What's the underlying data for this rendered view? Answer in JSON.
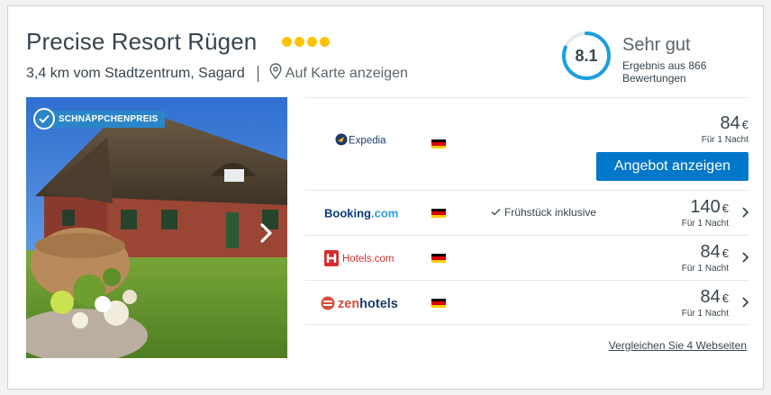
{
  "hotel": {
    "name": "Precise Resort Rügen",
    "stars": 4,
    "location": "3,4 km vom Stadtzentrum, Sagard",
    "map_link": "Auf Karte anzeigen"
  },
  "rating": {
    "score": "8.1",
    "score_fraction": 0.81,
    "label": "Sehr gut",
    "reviews": "Ergebnis aus 866 Bewertungen",
    "accent_color": "#1a9fe0"
  },
  "photo": {
    "badge": "SCHNÄPPCHENPREIS"
  },
  "offers": [
    {
      "provider": "Expedia",
      "country": "DE",
      "perk": "",
      "price": "84",
      "currency": "€",
      "per_night": "Für 1 Nacht",
      "cta": "Angebot anzeigen"
    },
    {
      "provider": "Booking.com",
      "country": "DE",
      "perk": "Frühstück inklusive",
      "price": "140",
      "currency": "€",
      "per_night": "Für 1 Nacht"
    },
    {
      "provider": "Hotels.com",
      "country": "DE",
      "perk": "",
      "price": "84",
      "currency": "€",
      "per_night": "Für 1 Nacht"
    },
    {
      "provider": "zenhotels",
      "country": "DE",
      "perk": "",
      "price": "84",
      "currency": "€",
      "per_night": "Für 1 Nacht"
    }
  ],
  "compare_link": "Vergleichen Sie 4 Webseiten",
  "colors": {
    "brand_blue": "#0077c8",
    "star": "#fdc200"
  }
}
